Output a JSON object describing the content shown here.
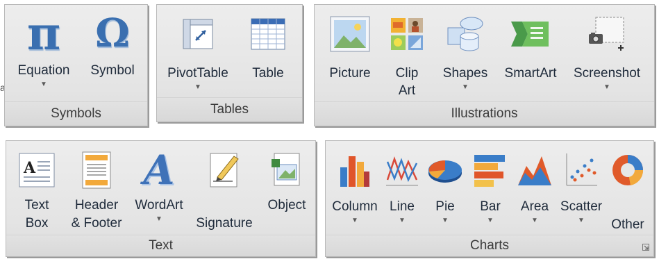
{
  "groups": {
    "symbols": {
      "label": "Symbols",
      "equation": "Equation",
      "symbol": "Symbol"
    },
    "tables": {
      "label": "Tables",
      "pivottable": "PivotTable",
      "table": "Table"
    },
    "illustrations": {
      "label": "Illustrations",
      "picture": "Picture",
      "clipart": "Clip\nArt",
      "shapes": "Shapes",
      "smartart": "SmartArt",
      "screenshot": "Screenshot"
    },
    "text": {
      "label": "Text",
      "textbox": "Text\nBox",
      "header": "Header\n& Footer",
      "wordart": "WordArt",
      "signature": "Signature\nLine",
      "object": "Object"
    },
    "charts": {
      "label": "Charts",
      "column": "Column",
      "line": "Line",
      "pie": "Pie",
      "bar": "Bar",
      "area": "Area",
      "scatter": "Scatter",
      "other": "Other\nCharts"
    }
  },
  "icons": {
    "pi": "π",
    "omega": "Ω",
    "textbox_letter": "A",
    "wordart_letter": "A",
    "caret": "▼"
  },
  "colors": {
    "symbol_blue": "#3a6fb0",
    "group_bg": "#e6e6e6"
  }
}
